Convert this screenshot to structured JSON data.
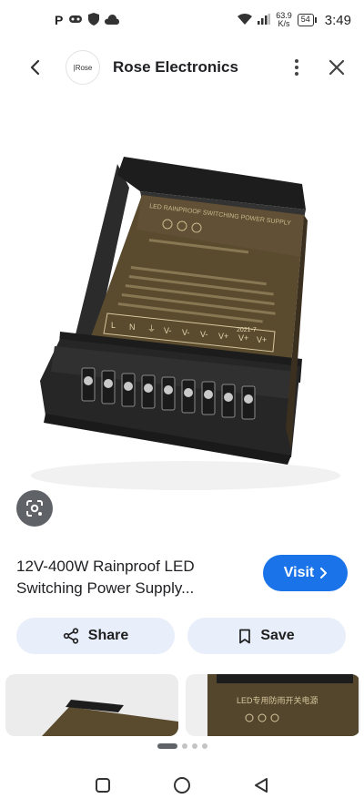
{
  "status_bar": {
    "icons": [
      "parking-icon",
      "gamepad-icon",
      "shield-icon",
      "cloud-icon",
      "wifi-icon",
      "signal-icon",
      "battery-icon"
    ],
    "net_speed_value": "63.9",
    "net_speed_unit": "K/s",
    "battery": "54",
    "time": "3:49"
  },
  "header": {
    "logo_text": "|Rose",
    "site_name": "Rose Electronics"
  },
  "product": {
    "label_header": "LED RAINPROOF SWITCHING POWER SUPPLY",
    "label_year": "2021-7",
    "terminal_labels": [
      "L",
      "N",
      "⏚",
      "V-",
      "V-",
      "V-",
      "V+",
      "V+",
      "V+"
    ],
    "thumb_label": "LED专用防雨开关电源"
  },
  "title": "12V-400W Rainproof LED Switching Power Supply...",
  "buttons": {
    "visit": "Visit",
    "share": "Share",
    "save": "Save"
  },
  "colors": {
    "accent": "#1a73e8",
    "chip_bg": "#e8eefa",
    "device_body": "#5b4a2c"
  },
  "pagination": {
    "total": 4,
    "active_index": 0
  }
}
